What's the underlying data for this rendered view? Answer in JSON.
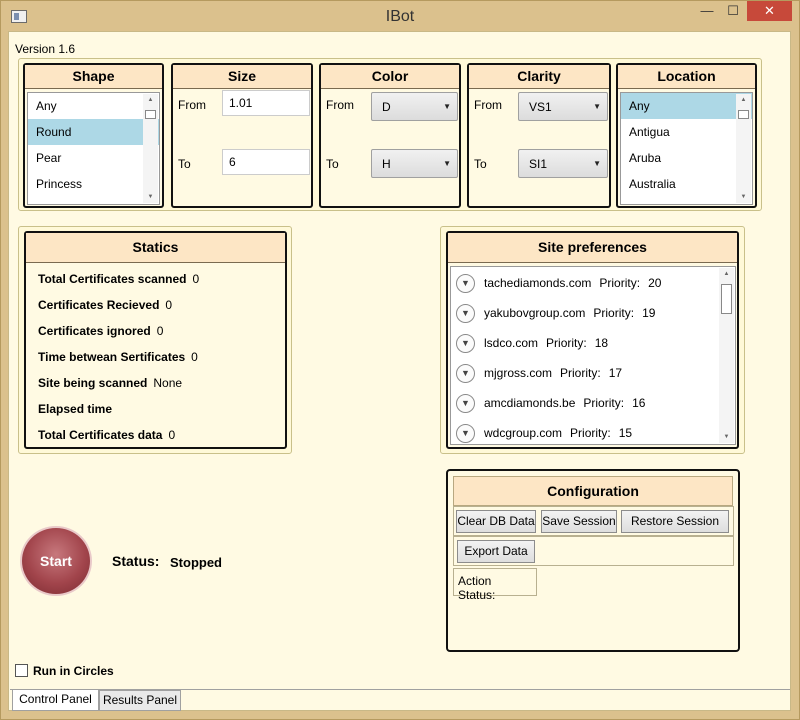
{
  "window": {
    "title": "IBot",
    "minimize": "—",
    "maximize": "☐",
    "close": "✕"
  },
  "version": "Version 1.6",
  "shape": {
    "header": "Shape",
    "items": [
      "Any",
      "Round",
      "Pear",
      "Princess"
    ],
    "selected": "Round"
  },
  "size": {
    "header": "Size",
    "from_label": "From",
    "from_value": "1.01",
    "to_label": "To",
    "to_value": "6"
  },
  "color": {
    "header": "Color",
    "from_label": "From",
    "from_value": "D",
    "to_label": "To",
    "to_value": "H"
  },
  "clarity": {
    "header": "Clarity",
    "from_label": "From",
    "from_value": "VS1",
    "to_label": "To",
    "to_value": "SI1"
  },
  "location": {
    "header": "Location",
    "items": [
      "Any",
      "Antigua",
      "Aruba",
      "Australia"
    ],
    "selected": "Any"
  },
  "statics": {
    "header": "Statics",
    "rows": [
      {
        "label": "Total Certificates scanned",
        "value": "0"
      },
      {
        "label": "Certificates Recieved",
        "value": "0"
      },
      {
        "label": "Certificates ignored",
        "value": "0"
      },
      {
        "label": "Time betwean Sertificates",
        "value": "0"
      },
      {
        "label": "Site being scanned",
        "value": "None"
      },
      {
        "label": "Elapsed time",
        "value": ""
      },
      {
        "label": "Total Certificates data",
        "value": "0"
      }
    ]
  },
  "site_prefs": {
    "header": "Site preferences",
    "priority_label": "Priority:",
    "sites": [
      {
        "name": "tachediamonds.com",
        "priority": "20"
      },
      {
        "name": "yakubovgroup.com",
        "priority": "19"
      },
      {
        "name": "lsdco.com",
        "priority": "18"
      },
      {
        "name": "mjgross.com",
        "priority": "17"
      },
      {
        "name": "amcdiamonds.be",
        "priority": "16"
      },
      {
        "name": "wdcgroup.com",
        "priority": "15"
      }
    ]
  },
  "config": {
    "header": "Configuration",
    "clear_db": "Clear DB Data",
    "save_session": "Save Session",
    "restore_session": "Restore Session",
    "export_data": "Export Data",
    "action_status": "Action Status:"
  },
  "start_label": "Start",
  "status": {
    "label": "Status:",
    "value": "Stopped"
  },
  "run_in_circles": "Run in Circles",
  "tabs": [
    "Control Panel",
    "Results Panel"
  ],
  "colors": {
    "panel_header": "#fde6c5",
    "selection": "#add8e6",
    "window_bg": "#dbc18d",
    "client_bg": "#fffae3",
    "start_button": "#a2454c"
  }
}
